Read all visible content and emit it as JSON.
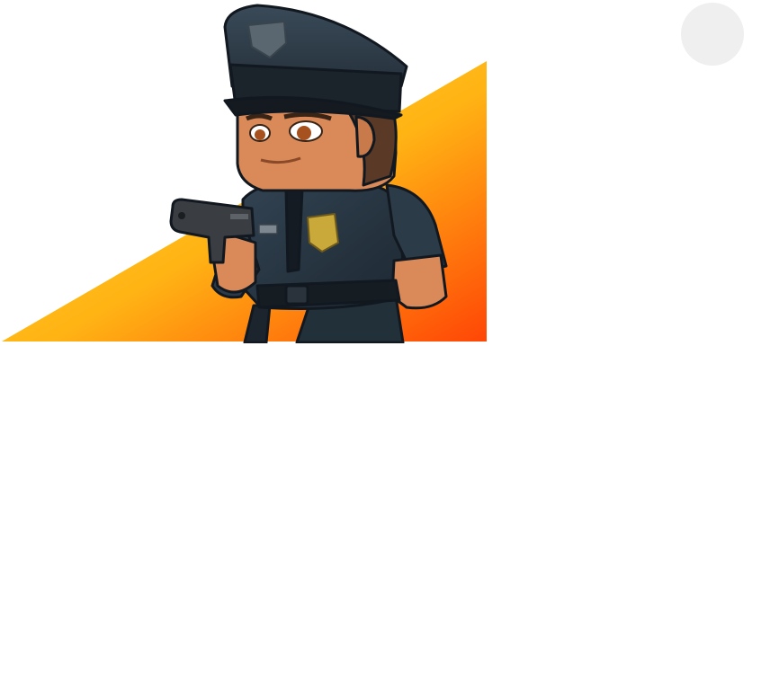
{
  "artwork": {
    "subject": "police-officer-character",
    "icon": "police-officer-icon",
    "colors": {
      "gradient_start": "#ffd21f",
      "gradient_mid": "#ffab12",
      "gradient_end": "#ff4a05",
      "uniform": "#26333f",
      "uniform_shadow": "#1a242d",
      "skin": "#d98a58",
      "badge": "#c9a93a",
      "pistol": "#3a3e42"
    }
  },
  "corner_button": {
    "icon": "circle-button-icon",
    "color": "#efefef"
  }
}
